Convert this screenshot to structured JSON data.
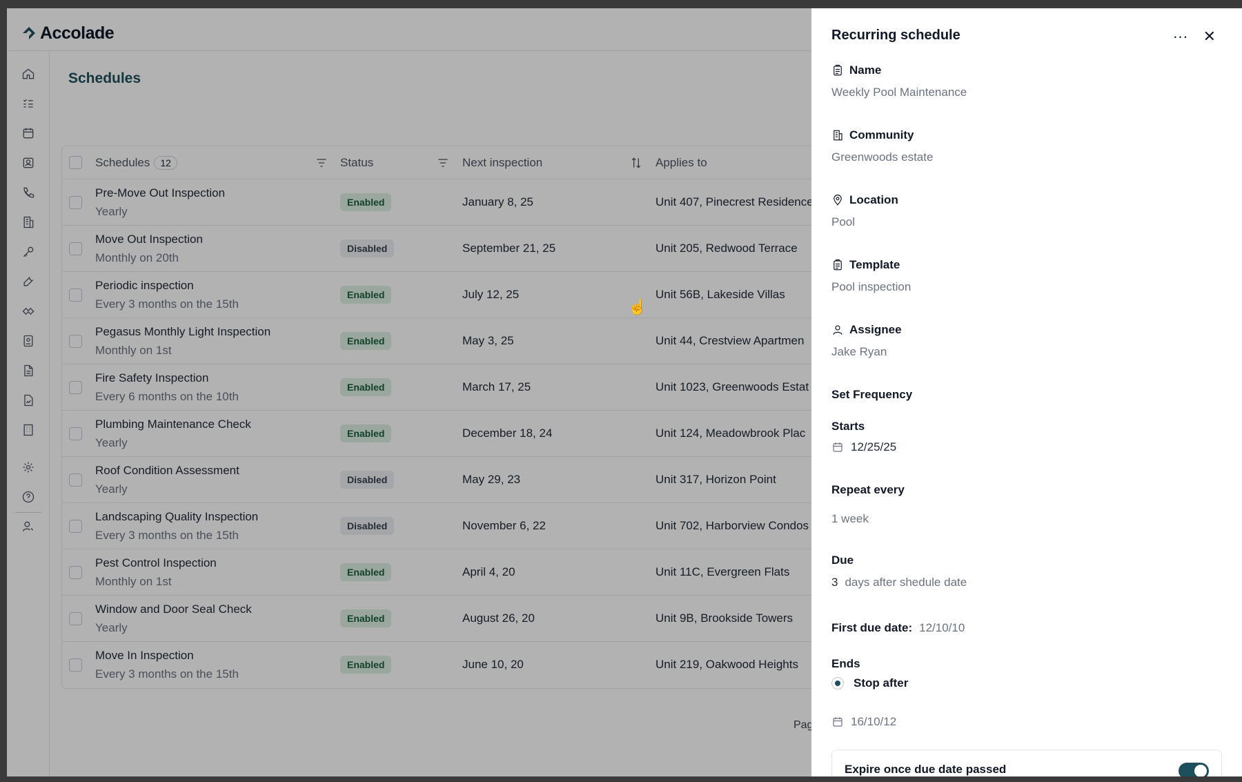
{
  "app": {
    "name": "Accolade"
  },
  "page": {
    "title": "Schedules",
    "pagination_label": "Pag"
  },
  "table": {
    "columns": {
      "schedules": "Schedules",
      "count": "12",
      "status": "Status",
      "next_inspection": "Next inspection",
      "applies_to": "Applies to"
    },
    "rows": [
      {
        "name": "Pre-Move Out Inspection",
        "frequency": "Yearly",
        "status": "Enabled",
        "next": "January 8, 25",
        "applies": "Unit 407, Pinecrest Residence"
      },
      {
        "name": "Move Out Inspection",
        "frequency": "Monthly on 20th",
        "status": "Disabled",
        "next": "September 21, 25",
        "applies": "Unit 205, Redwood Terrace"
      },
      {
        "name": "Periodic inspection",
        "frequency": "Every 3 months on the 15th",
        "status": "Enabled",
        "next": "July 12, 25",
        "applies": "Unit 56B, Lakeside Villas"
      },
      {
        "name": "Pegasus Monthly Light Inspection",
        "frequency": "Monthly on 1st",
        "status": "Enabled",
        "next": "May 3, 25",
        "applies": "Unit 44, Crestview Apartmen"
      },
      {
        "name": "Fire Safety Inspection",
        "frequency": "Every 6 months on the 10th",
        "status": "Enabled",
        "next": "March 17, 25",
        "applies": "Unit 1023, Greenwoods Estat"
      },
      {
        "name": "Plumbing Maintenance Check",
        "frequency": "Yearly",
        "status": "Enabled",
        "next": "December 18, 24",
        "applies": "Unit 124, Meadowbrook Plac"
      },
      {
        "name": "Roof Condition Assessment",
        "frequency": "Yearly",
        "status": "Disabled",
        "next": "May 29, 23",
        "applies": "Unit 317, Horizon Point"
      },
      {
        "name": "Landscaping Quality Inspection",
        "frequency": "Every 3 months on the 15th",
        "status": "Disabled",
        "next": "November 6, 22",
        "applies": "Unit 702, Harborview Condos"
      },
      {
        "name": "Pest Control Inspection",
        "frequency": "Monthly on 1st",
        "status": "Enabled",
        "next": "April 4, 20",
        "applies": "Unit 11C, Evergreen Flats"
      },
      {
        "name": "Window and Door Seal Check",
        "frequency": "Yearly",
        "status": "Enabled",
        "next": "August 26, 20",
        "applies": "Unit 9B, Brookside Towers"
      },
      {
        "name": "Move In Inspection",
        "frequency": "Every 3 months on the 15th",
        "status": "Enabled",
        "next": "June 10, 20",
        "applies": "Unit 219, Oakwood Heights"
      }
    ]
  },
  "panel": {
    "title": "Recurring schedule",
    "more_icon": "ellipsis-icon",
    "close_icon": "close-icon",
    "name_label": "Name",
    "name_value": "Weekly Pool Maintenance",
    "community_label": "Community",
    "community_value": "Greenwoods estate",
    "location_label": "Location",
    "location_value": "Pool",
    "template_label": "Template",
    "template_value": "Pool inspection",
    "assignee_label": "Assignee",
    "assignee_value": "Jake Ryan",
    "set_frequency": "Set Frequency",
    "starts_label": "Starts",
    "starts_value": "12/25/25",
    "repeat_label": "Repeat every",
    "repeat_value": "1 week",
    "due_label": "Due",
    "due_number": "3",
    "due_suffix": "days after shedule date",
    "first_due_label": "First due date:",
    "first_due_value": "12/10/10",
    "ends_label": "Ends",
    "ends_option": "Stop after",
    "ends_date": "16/10/12",
    "expire_label": "Expire once due date passed",
    "expire_enabled": true
  },
  "colors": {
    "accent": "#1e4f5c",
    "enabled_bg": "#dcefe3",
    "disabled_bg": "#eceef0"
  }
}
